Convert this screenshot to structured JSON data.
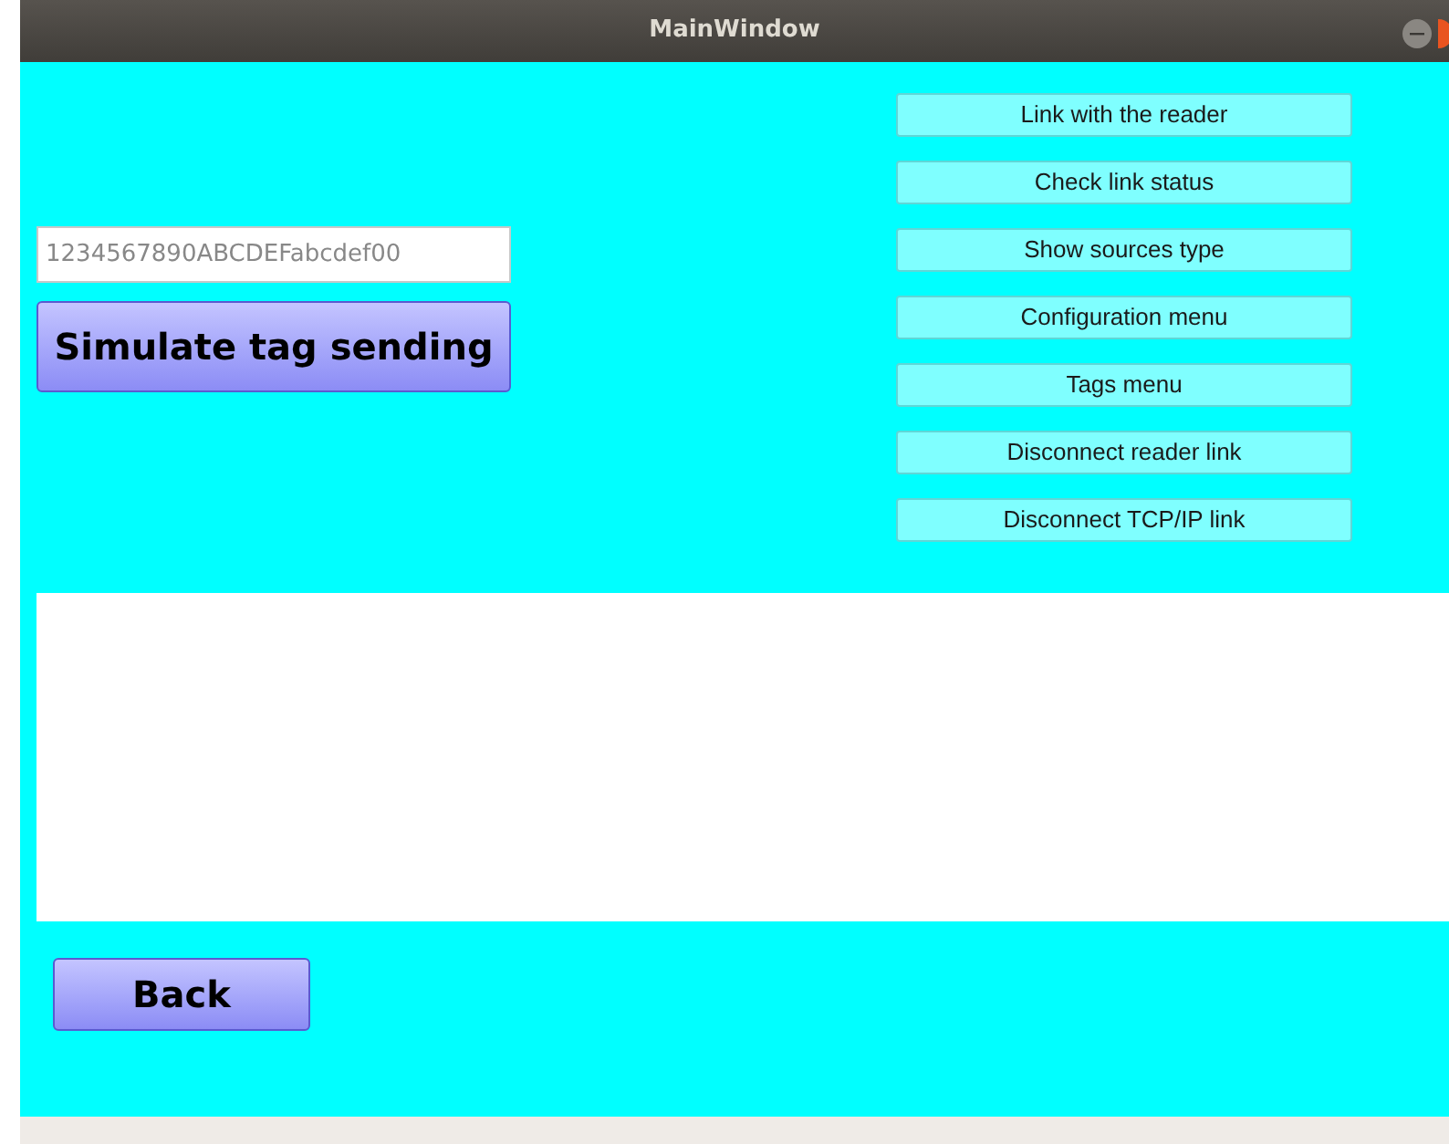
{
  "window": {
    "title": "MainWindow"
  },
  "tag_field": {
    "placeholder": "1234567890ABCDEFabcdef00"
  },
  "simulate_button": {
    "label": "Simulate tag sending"
  },
  "menu_buttons": [
    {
      "label": "Link with the reader"
    },
    {
      "label": "Check link status"
    },
    {
      "label": "Show sources type"
    },
    {
      "label": "Configuration menu"
    },
    {
      "label": "Tags menu"
    },
    {
      "label": "Disconnect reader link"
    },
    {
      "label": "Disconnect TCP/IP link"
    }
  ],
  "back_button": {
    "label": "Back"
  }
}
